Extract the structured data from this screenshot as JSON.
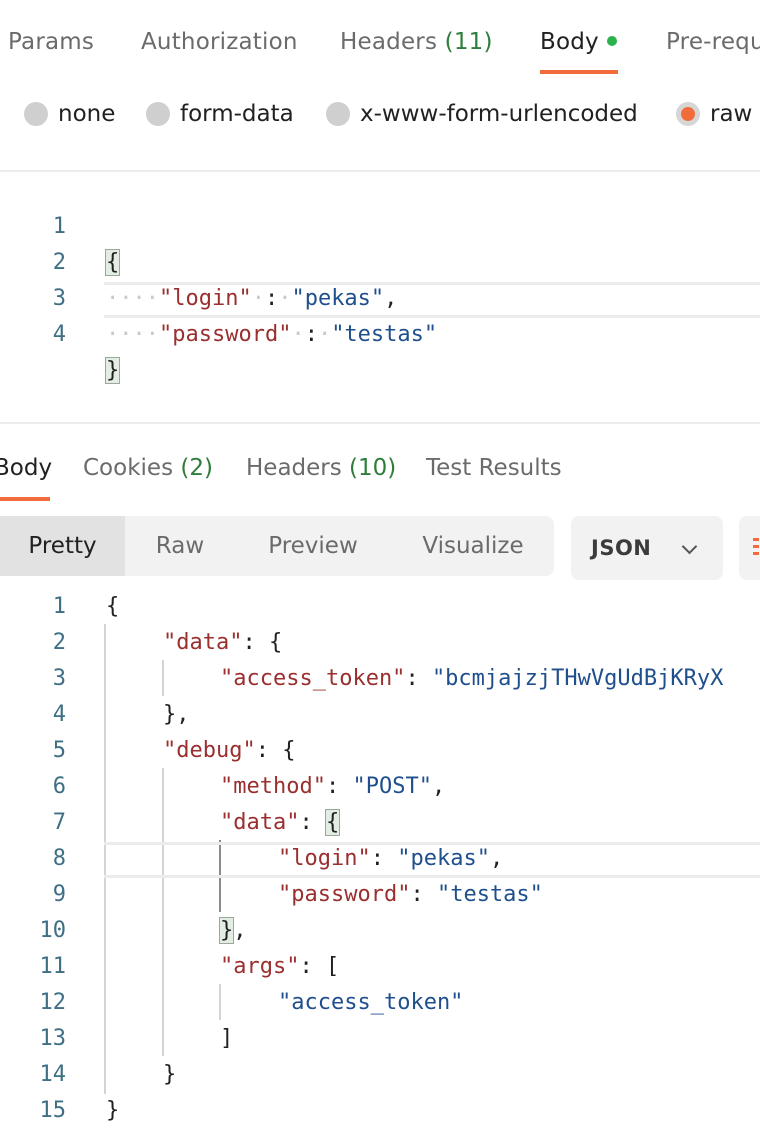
{
  "request_tabs": [
    {
      "label": "Params",
      "count": ""
    },
    {
      "label": "Authorization",
      "count": ""
    },
    {
      "label": "Headers",
      "count": "(11)"
    },
    {
      "label": "Body",
      "count": ""
    },
    {
      "label": "Pre-requ",
      "count": ""
    }
  ],
  "body_types": [
    {
      "label": "none",
      "selected": false
    },
    {
      "label": "form-data",
      "selected": false
    },
    {
      "label": "x-www-form-urlencoded",
      "selected": false
    },
    {
      "label": "raw",
      "selected": true
    }
  ],
  "request_body": {
    "lines": [
      {
        "n": "1",
        "open": "{"
      },
      {
        "n": "2",
        "key": "\"login\"",
        "sep": " : ",
        "value": "\"pekas\"",
        "tail": ","
      },
      {
        "n": "3",
        "key": "\"password\"",
        "sep": " : ",
        "value": "\"testas\"",
        "tail": ""
      },
      {
        "n": "4",
        "close": "}"
      }
    ]
  },
  "response_tabs": [
    {
      "label": "Body",
      "count": ""
    },
    {
      "label": "Cookies",
      "count": "(2)"
    },
    {
      "label": "Headers",
      "count": "(10)"
    },
    {
      "label": "Test Results",
      "count": ""
    }
  ],
  "view_modes": [
    "Pretty",
    "Raw",
    "Preview",
    "Visualize"
  ],
  "format": "JSON",
  "response_body": {
    "line_numbers": [
      "1",
      "2",
      "3",
      "4",
      "5",
      "6",
      "7",
      "8",
      "9",
      "10",
      "11",
      "12",
      "13",
      "14",
      "15"
    ],
    "l1": "{",
    "l2_key": "\"data\"",
    "l2_rest": ": {",
    "l3_key": "\"access_token\"",
    "l3_sep": ": ",
    "l3_val": "\"bcmjajzjTHwVgUdBjKRyX",
    "l4": "},",
    "l5_key": "\"debug\"",
    "l5_rest": ": {",
    "l6_key": "\"method\"",
    "l6_sep": ": ",
    "l6_val": "\"POST\"",
    "l6_tail": ",",
    "l7_key": "\"data\"",
    "l7_sep": ": ",
    "l7_brace": "{",
    "l8_key": "\"login\"",
    "l8_sep": ": ",
    "l8_val": "\"pekas\"",
    "l8_tail": ",",
    "l9_key": "\"password\"",
    "l9_sep": ": ",
    "l9_val": "\"testas\"",
    "l10_brace": "}",
    "l10_tail": ",",
    "l11_key": "\"args\"",
    "l11_rest": ": [",
    "l12_val": "\"access_token\"",
    "l13": "]",
    "l14": "}",
    "l15": "}"
  },
  "colors": {
    "accent": "#f26b3a",
    "count_green": "#2f7d3a",
    "key": "#9a2f2f",
    "string": "#1f4f8c",
    "line_number": "#3f6f84"
  }
}
